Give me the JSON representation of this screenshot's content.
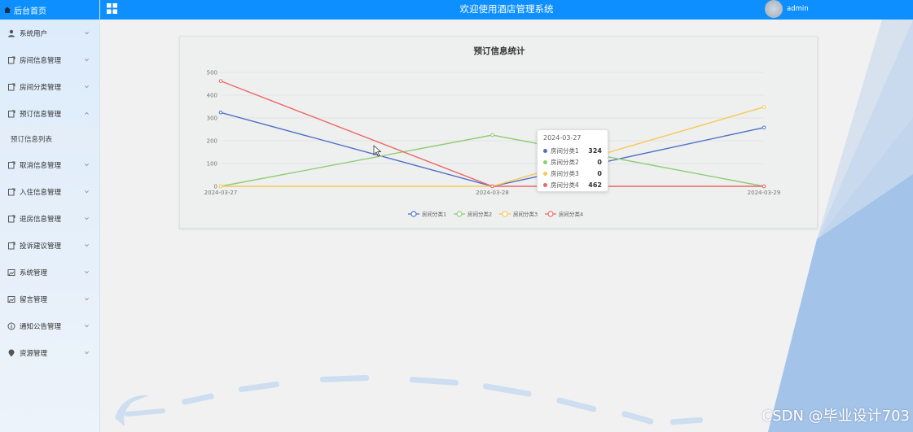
{
  "brand": {
    "title": "后台首页"
  },
  "header": {
    "title": "欢迎使用酒店管理系统",
    "username": "admin"
  },
  "sidebar": {
    "items": [
      {
        "label": "系统用户",
        "icon": "user-icon",
        "expanded": false
      },
      {
        "label": "房间信息管理",
        "icon": "doc-icon",
        "expanded": false
      },
      {
        "label": "房间分类管理",
        "icon": "doc-icon",
        "expanded": false
      },
      {
        "label": "预订信息管理",
        "icon": "doc-icon",
        "expanded": true,
        "children": [
          {
            "label": "预订信息列表"
          }
        ]
      },
      {
        "label": "取消信息管理",
        "icon": "doc-icon",
        "expanded": false
      },
      {
        "label": "入住信息管理",
        "icon": "doc-icon",
        "expanded": false
      },
      {
        "label": "退房信息管理",
        "icon": "doc-icon",
        "expanded": false
      },
      {
        "label": "投诉建议管理",
        "icon": "doc-icon",
        "expanded": false
      },
      {
        "label": "系统管理",
        "icon": "image-icon",
        "expanded": false
      },
      {
        "label": "留言管理",
        "icon": "image-icon",
        "expanded": false
      },
      {
        "label": "通知公告管理",
        "icon": "info-icon",
        "expanded": false
      },
      {
        "label": "资源管理",
        "icon": "location-icon",
        "expanded": false
      }
    ]
  },
  "colors": {
    "header_bg": "#0d8fff",
    "series1": "#5470c6",
    "series2": "#91cc75",
    "series3": "#fac858",
    "series4": "#ee6666"
  },
  "chart_data": {
    "type": "line",
    "title": "预订信息统计",
    "categories": [
      "2024-03-27",
      "2024-03-28",
      "2024-03-29"
    ],
    "ylim": [
      0,
      500
    ],
    "yticks": [
      0,
      100,
      200,
      300,
      400,
      500
    ],
    "grid": true,
    "legend_position": "bottom",
    "series": [
      {
        "name": "房间分类1",
        "values": [
          324,
          0,
          258
        ]
      },
      {
        "name": "房间分类2",
        "values": [
          0,
          225,
          0
        ]
      },
      {
        "name": "房间分类3",
        "values": [
          0,
          0,
          348
        ]
      },
      {
        "name": "房间分类4",
        "values": [
          462,
          0,
          0
        ]
      }
    ]
  },
  "tooltip": {
    "date": "2024-03-27",
    "rows": [
      {
        "name": "房间分类1",
        "value": "324"
      },
      {
        "name": "房间分类2",
        "value": "0"
      },
      {
        "name": "房间分类3",
        "value": "0"
      },
      {
        "name": "房间分类4",
        "value": "462"
      }
    ]
  },
  "watermark": "CSDN @毕业设计703"
}
